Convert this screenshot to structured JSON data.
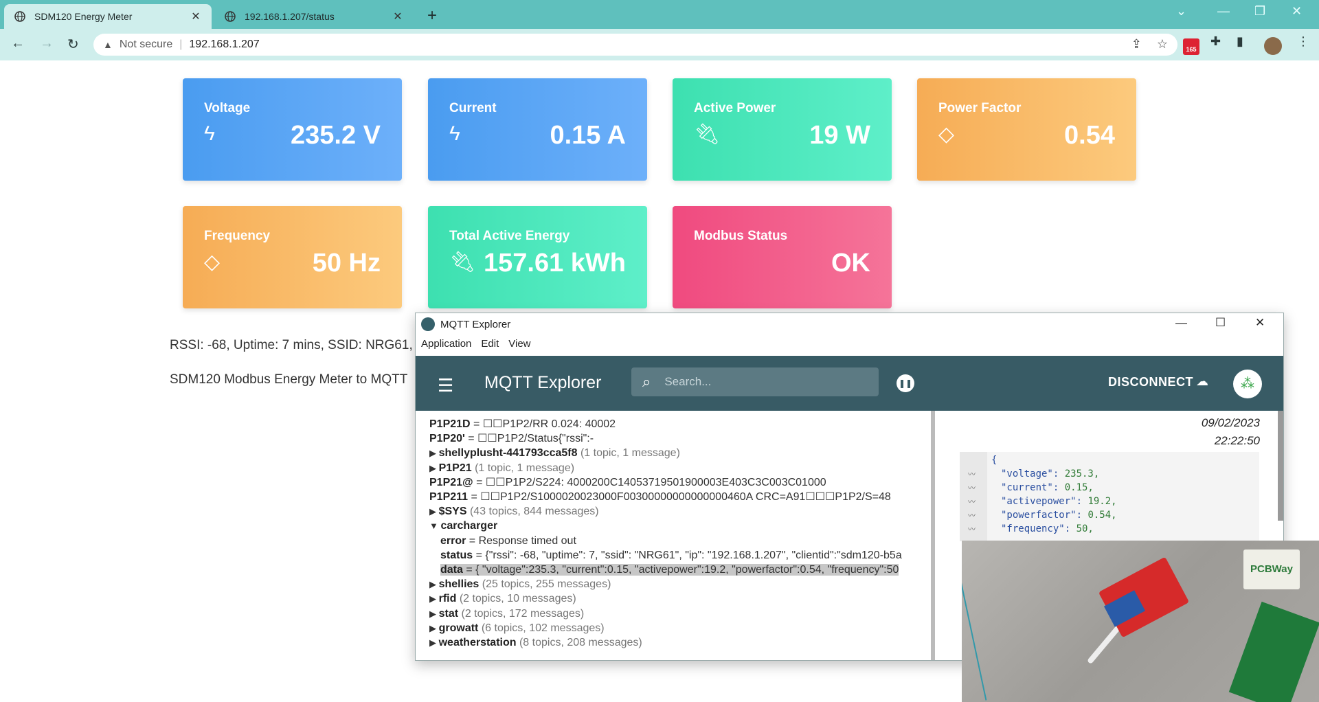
{
  "browser": {
    "tabs": [
      {
        "title": "SDM120 Energy Meter",
        "close": "✕"
      },
      {
        "title": "192.168.1.207/status",
        "close": "✕"
      }
    ],
    "security_label": "Not secure",
    "url": "192.168.1.207",
    "badge_count": "165"
  },
  "cards": [
    {
      "label": "Voltage",
      "value": "235.2 V",
      "icon": "bolt-icon"
    },
    {
      "label": "Current",
      "value": "0.15 A",
      "icon": "bolt-icon"
    },
    {
      "label": "Active Power",
      "value": "19 W",
      "icon": "plug-icon"
    },
    {
      "label": "Power Factor",
      "value": "0.54",
      "icon": "diamond-icon"
    },
    {
      "label": "Frequency",
      "value": "50 Hz",
      "icon": "diamond-icon"
    },
    {
      "label": "Total Active Energy",
      "value": "157.61 kWh",
      "icon": "plug-icon"
    },
    {
      "label": "Modbus Status",
      "value": "OK",
      "icon": ""
    }
  ],
  "page": {
    "status_line": "RSSI: -68, Uptime: 7 mins, SSID: NRG61, I",
    "footer_line": "SDM120 Modbus Energy Meter to MQTT"
  },
  "mqtt": {
    "window_title": "MQTT Explorer",
    "menu": [
      "Application",
      "Edit",
      "View"
    ],
    "brand": "MQTT Explorer",
    "search_placeholder": "Search...",
    "disconnect_label": "DISCONNECT",
    "tree": [
      {
        "indent": 0,
        "arrow": "",
        "key": "P1P21D",
        "rest": " = ☐☐P1P2/RR 0.024: 40002",
        "meta": ""
      },
      {
        "indent": 0,
        "arrow": "",
        "key": "P1P20'",
        "rest": " = ☐☐P1P2/Status{\"rssi\":-",
        "meta": ""
      },
      {
        "indent": 0,
        "arrow": "▶",
        "key": "shellyplusht-441793cca5f8",
        "rest": "",
        "meta": " (1 topic, 1 message)"
      },
      {
        "indent": 0,
        "arrow": "▶",
        "key": "P1P21",
        "rest": "",
        "meta": " (1 topic, 1 message)"
      },
      {
        "indent": 0,
        "arrow": "",
        "key": "P1P21@",
        "rest": " = ☐☐P1P2/S224: 4000200C14053719501900003E403C3C003C01000",
        "meta": ""
      },
      {
        "indent": 0,
        "arrow": "",
        "key": "P1P211",
        "rest": " = ☐☐P1P2/S1000020023000F00300000000000000460A CRC=A91☐☐☐P1P2/S=48",
        "meta": ""
      },
      {
        "indent": 0,
        "arrow": "▶",
        "key": "$SYS",
        "rest": "",
        "meta": " (43 topics, 844 messages)"
      },
      {
        "indent": 0,
        "arrow": "▼",
        "key": "carcharger",
        "rest": "",
        "meta": ""
      },
      {
        "indent": 1,
        "arrow": "",
        "key": "error",
        "rest": " = Response timed out",
        "meta": ""
      },
      {
        "indent": 1,
        "arrow": "",
        "key": "status",
        "rest": " = {\"rssi\": -68, \"uptime\": 7, \"ssid\": \"NRG61\", \"ip\": \"192.168.1.207\", \"clientid\":\"sdm120-b5a",
        "meta": ""
      },
      {
        "indent": 1,
        "arrow": "",
        "key": "data",
        "rest": " = { \"voltage\":235.3, \"current\":0.15, \"activepower\":19.2, \"powerfactor\":0.54, \"frequency\":50",
        "meta": "",
        "highlight": true
      },
      {
        "indent": 0,
        "arrow": "▶",
        "key": "shellies",
        "rest": "",
        "meta": " (25 topics, 255 messages)"
      },
      {
        "indent": 0,
        "arrow": "▶",
        "key": "rfid",
        "rest": "",
        "meta": " (2 topics, 10 messages)"
      },
      {
        "indent": 0,
        "arrow": "▶",
        "key": "stat",
        "rest": "",
        "meta": " (2 topics, 172 messages)"
      },
      {
        "indent": 0,
        "arrow": "▶",
        "key": "growatt",
        "rest": "",
        "meta": " (6 topics, 102 messages)"
      },
      {
        "indent": 0,
        "arrow": "▶",
        "key": "weatherstation",
        "rest": "",
        "meta": " (8 topics, 208 messages)"
      }
    ],
    "detail": {
      "date": "09/02/2023",
      "time": "22:22:50",
      "json_lines": [
        {
          "key": "{",
          "val": ""
        },
        {
          "key": "\"voltage\": ",
          "val": "235.3,"
        },
        {
          "key": "\"current\": ",
          "val": "0.15,"
        },
        {
          "key": "\"activepower\": ",
          "val": "19.2,"
        },
        {
          "key": "\"powerfactor\": ",
          "val": "0.54,"
        },
        {
          "key": "\"frequency\": ",
          "val": "50,"
        }
      ]
    }
  },
  "camera": {
    "sticker_text": "PCBWay"
  }
}
